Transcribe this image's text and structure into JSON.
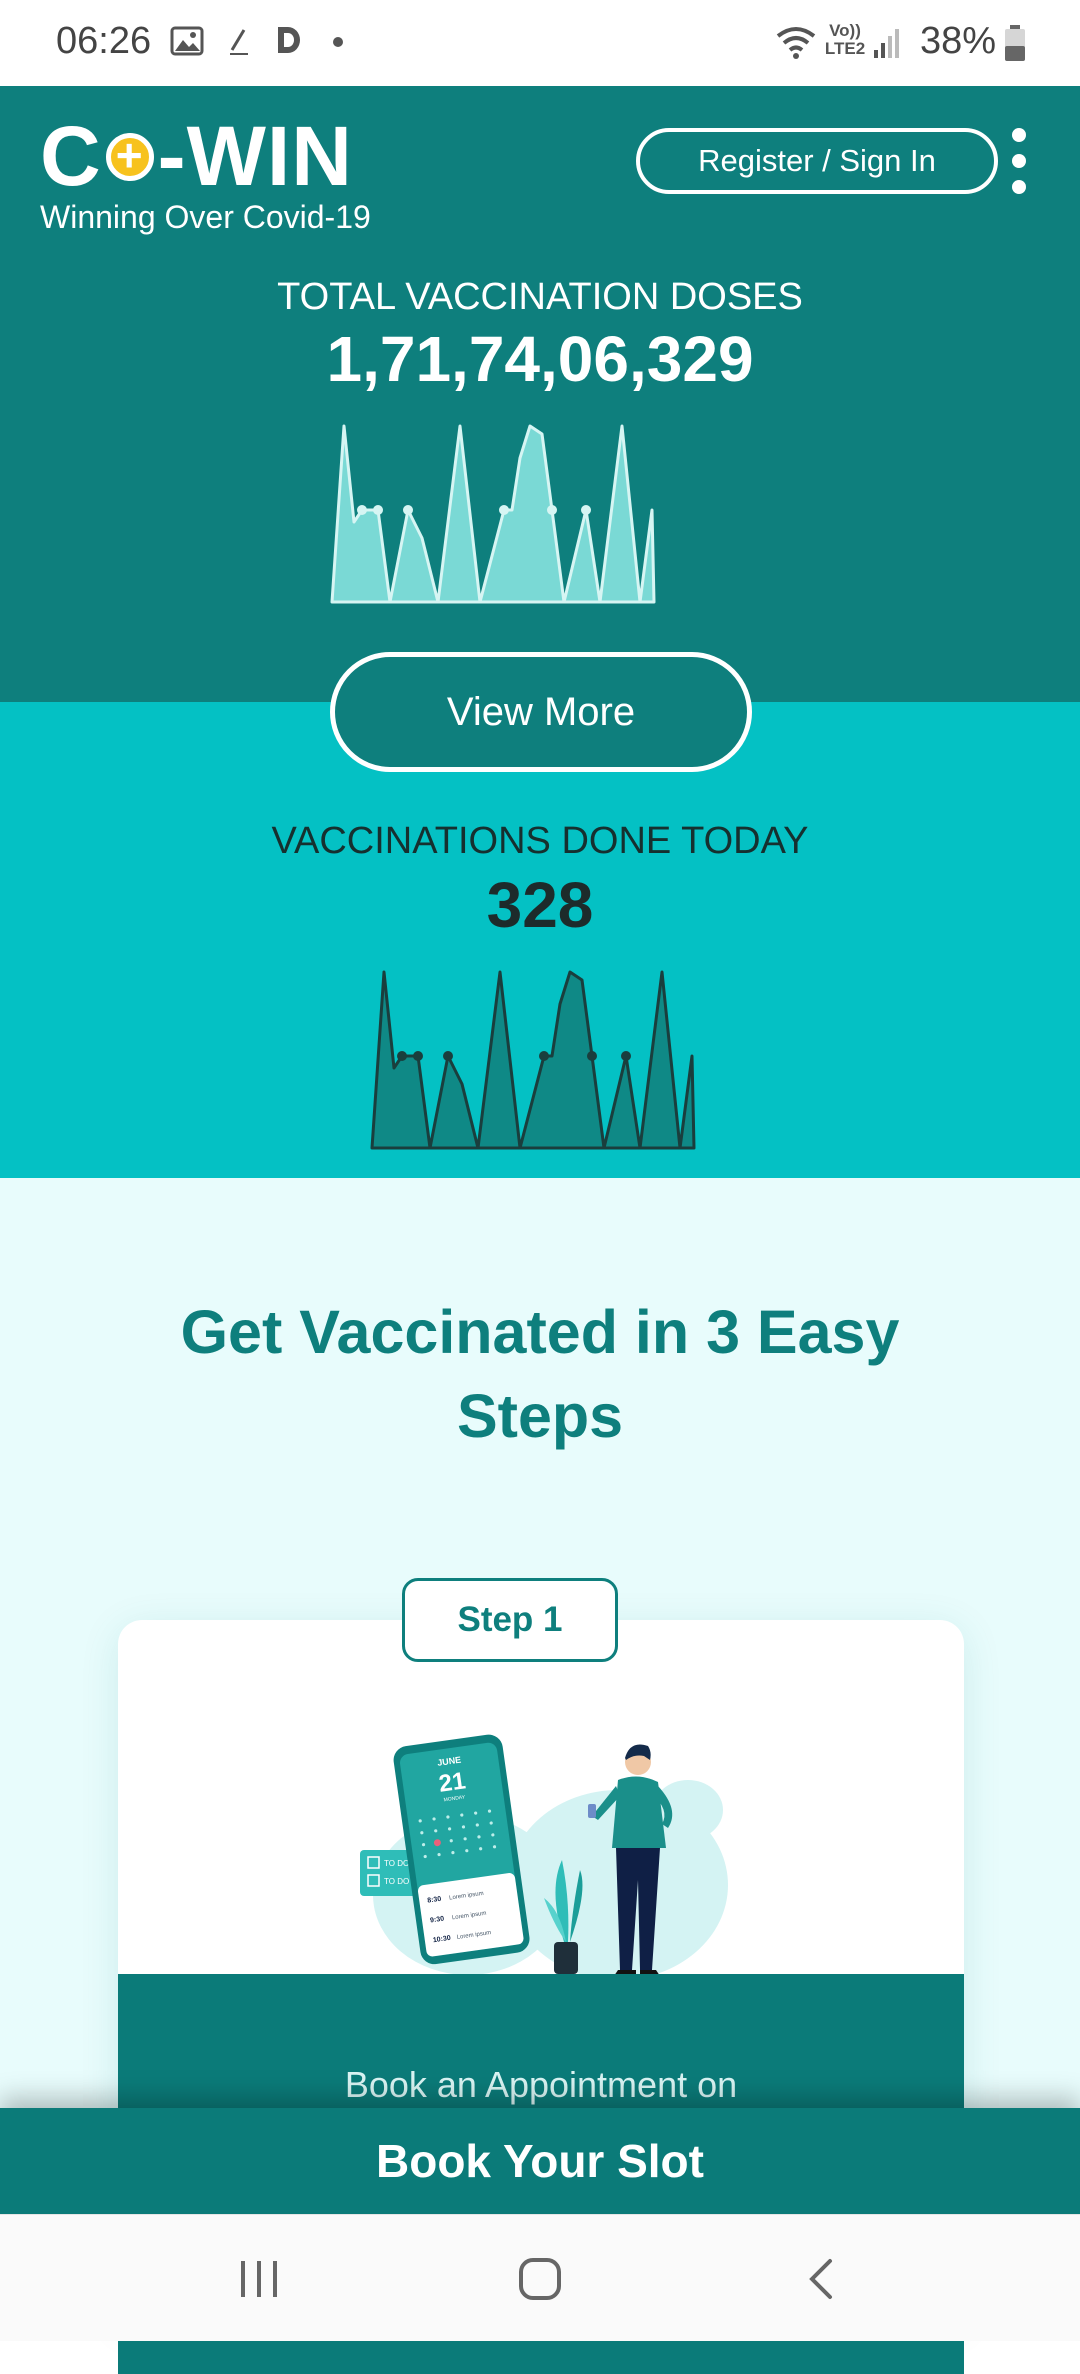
{
  "status_bar": {
    "time": "06:26",
    "network": "Vo)) LTE2",
    "battery": "38%"
  },
  "header": {
    "logo_left": "C",
    "logo_right": "-WIN",
    "tagline": "Winning Over Covid-19",
    "signin_label": "Register / Sign In"
  },
  "total_doses": {
    "label": "TOTAL VACCINATION DOSES",
    "value": "1,71,74,06,329"
  },
  "view_more_label": "View More",
  "today": {
    "label": "VACCINATIONS DONE TODAY",
    "value": "328"
  },
  "steps": {
    "title": "Get Vaccinated in 3 Easy Steps",
    "step_badge": "Step 1",
    "step_text": "Book an Appointment on",
    "illustration": {
      "month": "JUNE",
      "day": "21",
      "weekday": "MONDAY",
      "todo1": "TO DO",
      "todo2": "TO DO",
      "slot1_time": "8:30",
      "slot2_time": "9:30",
      "slot3_time": "10:30",
      "slot_text": "Lorem ipsum"
    }
  },
  "book_slot_label": "Book Your Slot",
  "colors": {
    "primary": "#0e7f7d",
    "secondary": "#04c1c4",
    "background_light": "#e8fcfc",
    "accent_yellow": "#f7c21d"
  }
}
